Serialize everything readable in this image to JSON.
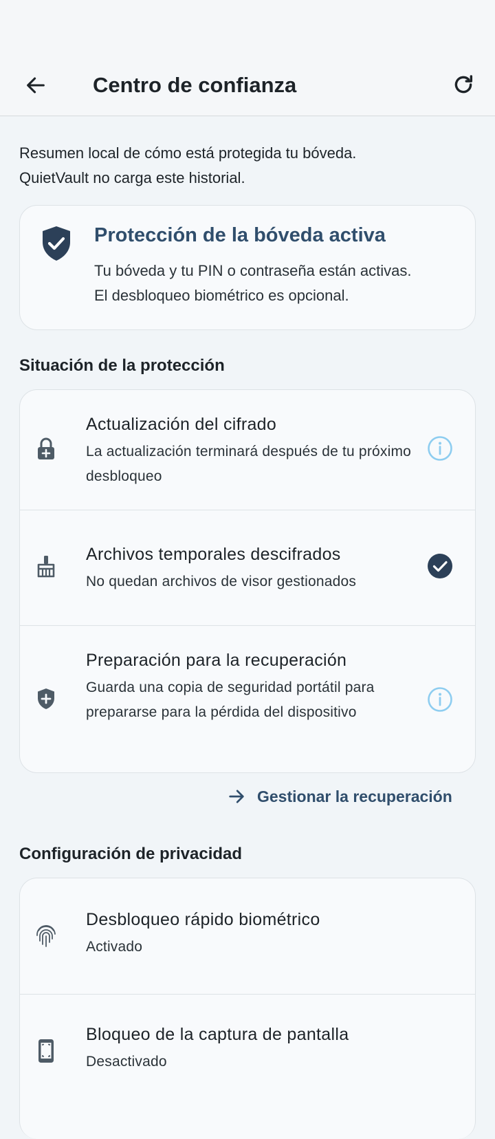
{
  "header": {
    "title": "Centro de confianza"
  },
  "intro": {
    "line1": "Resumen local de cómo está protegida tu bóveda.",
    "line2": "QuietVault no carga este historial."
  },
  "hero": {
    "title": "Protección de la bóveda activa",
    "line1": "Tu bóveda y tu PIN o contraseña están activas.",
    "line2": "El desbloqueo biométrico es opcional."
  },
  "protection": {
    "section_title": "Situación de la protección",
    "items": [
      {
        "icon": "lock-plus-icon",
        "title": "Actualización del cifrado",
        "subtitle": "La actualización terminará después de tu próximo desbloqueo",
        "status_icon": "info-icon"
      },
      {
        "icon": "broom-icon",
        "title": "Archivos temporales descifrados",
        "subtitle": "No quedan archivos de visor gestionados",
        "status_icon": "check-circle-icon"
      },
      {
        "icon": "shield-plus-icon",
        "title": "Preparación para la recuperación",
        "subtitle": "Guarda una copia de seguridad portátil para prepararse para la pérdida del dispositivo",
        "status_icon": "info-icon"
      }
    ],
    "link_label": "Gestionar la recuperación"
  },
  "privacy": {
    "section_title": "Configuración de privacidad",
    "items": [
      {
        "icon": "fingerprint-icon",
        "title": "Desbloqueo rápido biométrico",
        "subtitle": "Activado"
      },
      {
        "icon": "screenshot-block-icon",
        "title": "Bloqueo de la captura de pantalla",
        "subtitle": "Desactivado"
      }
    ]
  },
  "colors": {
    "accent": "#304e6c",
    "info": "#8ecdf0",
    "success": "#2c4058",
    "background": "#f1f5f8"
  }
}
